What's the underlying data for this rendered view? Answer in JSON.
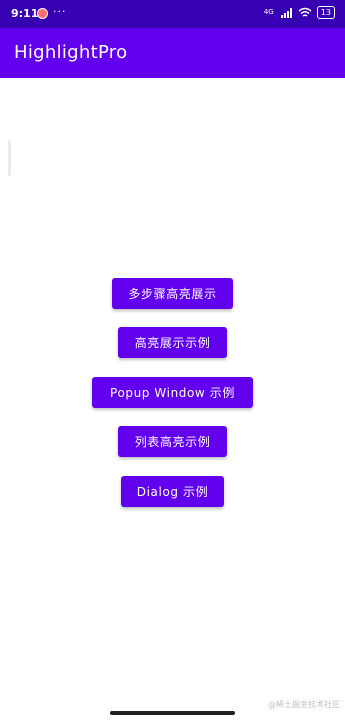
{
  "status_bar": {
    "time": "9:11",
    "more": "···",
    "network": "4G",
    "battery": "13"
  },
  "app_bar": {
    "title": "HighlightPro"
  },
  "buttons": {
    "multi_step": "多步骤高亮展示",
    "highlight_example": "高亮展示示例",
    "popup_window": "Popup Window 示例",
    "list_highlight": "列表高亮示例",
    "dialog": "Dialog 示例"
  },
  "watermark": "@稀土掘金技术社区",
  "colors": {
    "primary": "#6200ee",
    "primary_dark": "#3700b3",
    "on_primary": "#ffffff",
    "background": "#ffffff"
  }
}
